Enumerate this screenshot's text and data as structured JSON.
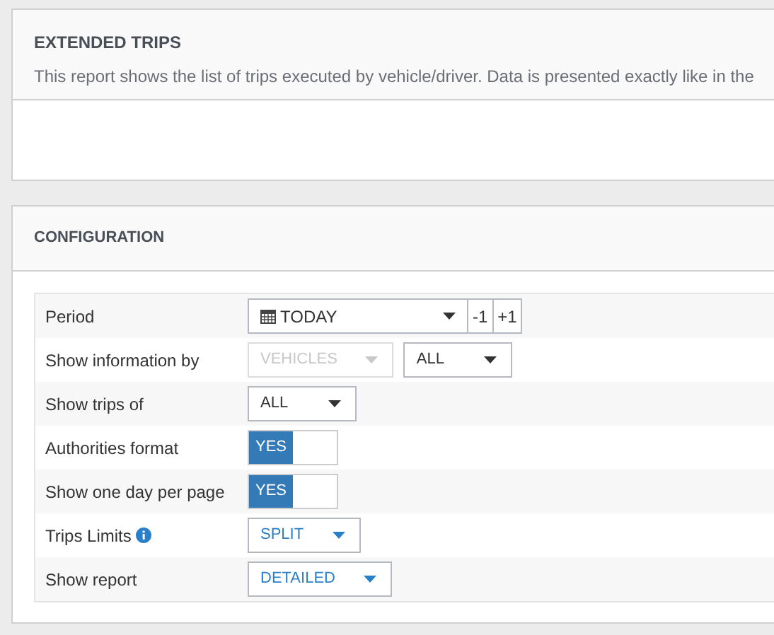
{
  "report": {
    "title": "EXTENDED TRIPS",
    "description": "This report shows the list of trips executed by vehicle/driver. Data is presented exactly like in the"
  },
  "configuration": {
    "title": "CONFIGURATION",
    "rows": [
      {
        "label": "Period",
        "info": false,
        "controls": [
          {
            "kind": "date-select",
            "value": "TODAY",
            "disabled": false
          },
          {
            "kind": "step",
            "value": "-1"
          },
          {
            "kind": "step",
            "value": "+1"
          }
        ]
      },
      {
        "label": "Show information by",
        "info": false,
        "controls": [
          {
            "kind": "select",
            "value": "VEHICLES",
            "disabled": true
          },
          {
            "kind": "select",
            "value": "ALL",
            "disabled": false
          }
        ]
      },
      {
        "label": "Show trips of",
        "info": false,
        "controls": [
          {
            "kind": "select",
            "value": "ALL",
            "disabled": false
          }
        ]
      },
      {
        "label": "Authorities format",
        "info": false,
        "controls": [
          {
            "kind": "toggle",
            "value": "YES",
            "on": true
          }
        ]
      },
      {
        "label": "Show one day per page",
        "info": false,
        "controls": [
          {
            "kind": "toggle",
            "value": "YES",
            "on": true
          }
        ]
      },
      {
        "label": "Trips Limits",
        "info": true,
        "controls": [
          {
            "kind": "accent-select",
            "value": "SPLIT",
            "disabled": false
          }
        ]
      },
      {
        "label": "Show report",
        "info": false,
        "controls": [
          {
            "kind": "accent-select",
            "value": "DETAILED",
            "disabled": false
          }
        ]
      }
    ]
  }
}
